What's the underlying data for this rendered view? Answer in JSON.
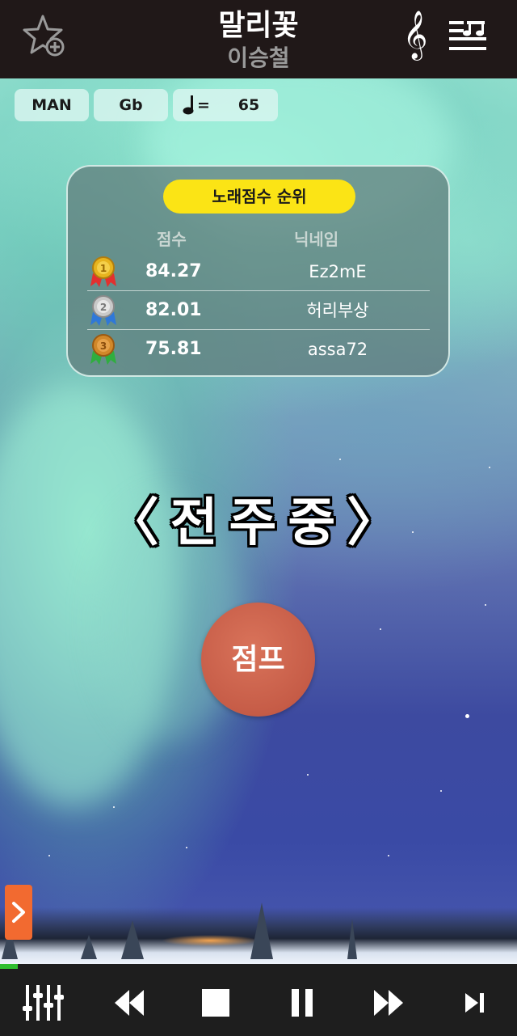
{
  "header": {
    "title": "말리꽃",
    "artist": "이승철",
    "favorite_icon": "star-plus-icon",
    "clef_icon": "treble-clef-icon",
    "clef_glyph": "𝄞",
    "score_icon": "sheet-music-icon"
  },
  "info": {
    "mode": "MAN",
    "key": "Gb",
    "tempo_equals": "=",
    "tempo": "65"
  },
  "ranking": {
    "title": "노래점수 순위",
    "score_header": "점수",
    "nickname_header": "닉네임",
    "rows": [
      {
        "rank": 1,
        "score": "84.27",
        "nickname": "Ez2mE",
        "medal": "gold"
      },
      {
        "rank": 2,
        "score": "82.01",
        "nickname": "허리부상",
        "medal": "silver"
      },
      {
        "rank": 3,
        "score": "75.81",
        "nickname": "assa72",
        "medal": "bronze"
      }
    ]
  },
  "prelude_text": "〈전주중〉",
  "jump_label": "점프",
  "progress": 0.035,
  "colors": {
    "accent_yellow": "#fbe415",
    "jump_button": "#c65c47",
    "side_toggle": "#f26a30",
    "progress": "#2fbf2f",
    "bar_background": "#1e1e1e"
  },
  "controls": [
    "equalizer-icon",
    "rewind-icon",
    "stop-icon",
    "pause-icon",
    "fast-forward-icon",
    "skip-next-icon"
  ]
}
